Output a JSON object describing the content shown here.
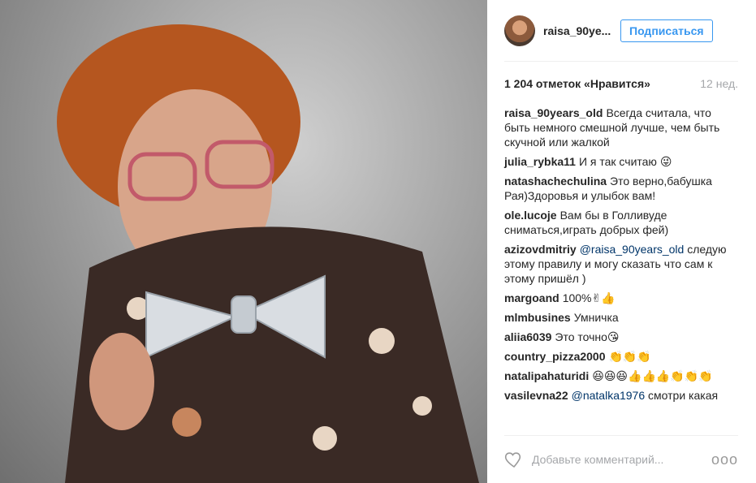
{
  "header": {
    "username": "raisa_90ye...",
    "follow_label": "Подписаться"
  },
  "stats": {
    "likes": "1 204 отметок «Нравится»",
    "time": "12 нед."
  },
  "comments": [
    {
      "user": "raisa_90years_old",
      "text": "Всегда считала, что быть немного смешной лучше, чем быть скучной или жалкой",
      "mention": ""
    },
    {
      "user": "julia_rybka11",
      "text": "И я так считаю 😜",
      "mention": ""
    },
    {
      "user": "natashachechulina",
      "text": "Это верно,бабушка Рая)Здоровья и улыбок вам!",
      "mention": ""
    },
    {
      "user": "ole.lucoje",
      "text": "Вам бы в Голливуде сниматься,играть добрых фей)",
      "mention": ""
    },
    {
      "user": "azizovdmitriy",
      "mention": "@raisa_90years_old",
      "text": "следую этому правилу и могу сказать что сам к этому пришёл )"
    },
    {
      "user": "margoand",
      "text": "100%✌👍",
      "mention": ""
    },
    {
      "user": "mlmbusines",
      "text": "Умничка",
      "mention": ""
    },
    {
      "user": "aliia6039",
      "text": "Это точно😘",
      "mention": ""
    },
    {
      "user": "country_pizza2000",
      "text": "👏👏👏",
      "mention": ""
    },
    {
      "user": "natalipahaturidi",
      "text": "😆😆😆👍👍👍👏👏👏",
      "mention": ""
    },
    {
      "user": "vasilevna22",
      "mention": "@natalka1976",
      "text": "смотри какая"
    }
  ],
  "footer": {
    "comment_placeholder": "Добавьте комментарий...",
    "more_label": "ooo"
  },
  "icons": {
    "heart": "heart-icon",
    "more": "more-options-icon"
  }
}
